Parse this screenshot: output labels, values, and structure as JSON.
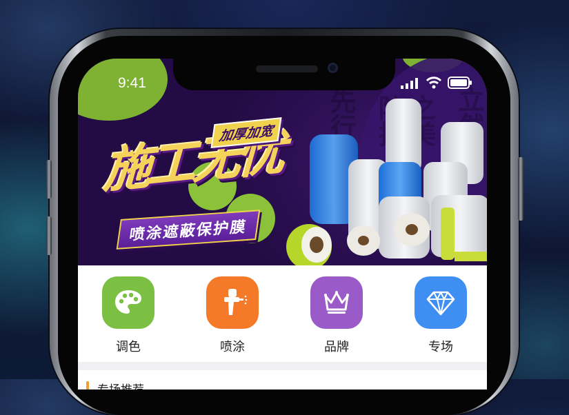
{
  "status_bar": {
    "time": "9:41"
  },
  "banner": {
    "title": "施工无忧",
    "tag": "加厚加宽",
    "subtitle": "喷涂遮蔽保护膜",
    "background_words": [
      "先行",
      "防护",
      "之美",
      "立然"
    ]
  },
  "categories": [
    {
      "label": "调色",
      "icon": "palette-icon",
      "color": "#7cc043"
    },
    {
      "label": "喷涂",
      "icon": "spray-gun-icon",
      "color": "#f47a2a"
    },
    {
      "label": "品牌",
      "icon": "crown-icon",
      "color": "#9a5bc8"
    },
    {
      "label": "专场",
      "icon": "diamond-icon",
      "color": "#3f8ef2"
    }
  ],
  "section": {
    "title": "专场推荐"
  },
  "colors": {
    "banner_bg": "#2b0f52",
    "accent_yellow": "#f5d35b",
    "section_accent": "#f39c2f"
  }
}
